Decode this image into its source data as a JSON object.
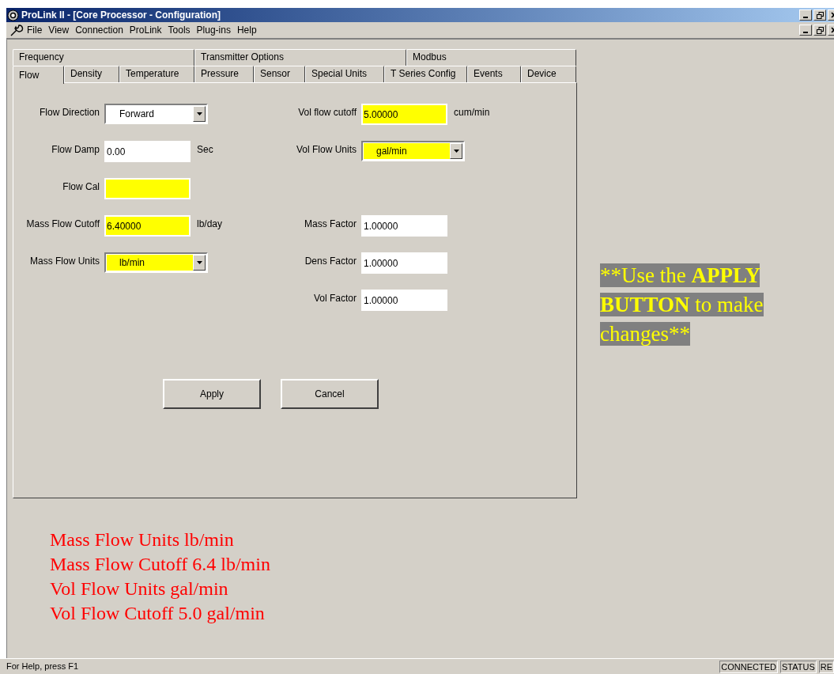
{
  "window": {
    "title": "ProLink II - [Core Processor - Configuration]"
  },
  "menu": [
    "File",
    "View",
    "Connection",
    "ProLink",
    "Tools",
    "Plug-ins",
    "Help"
  ],
  "tab_rows": [
    [
      {
        "label": "Frequency",
        "selected": false
      },
      {
        "label": "Transmitter Options",
        "selected": false
      },
      {
        "label": "Modbus",
        "selected": false
      }
    ],
    [
      {
        "label": "Flow",
        "selected": true
      },
      {
        "label": "Density",
        "selected": false
      },
      {
        "label": "Temperature",
        "selected": false
      },
      {
        "label": "Pressure",
        "selected": false
      },
      {
        "label": "Sensor",
        "selected": false
      },
      {
        "label": "Special Units",
        "selected": false
      },
      {
        "label": "T Series Config",
        "selected": false
      },
      {
        "label": "Events",
        "selected": false
      },
      {
        "label": "Device",
        "selected": false
      }
    ]
  ],
  "form_rows": [
    {
      "left": {
        "label": "Flow Direction",
        "kind": "dropdown",
        "value": "Forward",
        "highlighted": false
      },
      "right": {
        "label": "Vol flow cutoff",
        "kind": "text",
        "value": "5.00000",
        "highlighted": true,
        "unit": "cum/min"
      }
    },
    {
      "left": {
        "label": "Flow Damp",
        "kind": "text",
        "value": "0.00",
        "highlighted": false,
        "unit": "Sec"
      },
      "right": {
        "label": "Vol Flow Units",
        "kind": "dropdown",
        "value": "gal/min",
        "highlighted": true
      }
    },
    {
      "left": {
        "label": "Flow Cal",
        "kind": "text",
        "highlighted": true
      }
    },
    {
      "left": {
        "label": "Mass Flow Cutoff",
        "kind": "text",
        "value": "6.40000",
        "highlighted": true,
        "unit": "lb/day"
      },
      "right": {
        "label": "Mass Factor",
        "kind": "text",
        "value": "1.00000",
        "highlighted": false
      }
    },
    {
      "left": {
        "label": "Mass Flow Units",
        "kind": "dropdown",
        "value": "lb/min",
        "highlighted": true
      },
      "right": {
        "label": "Dens Factor",
        "kind": "text",
        "value": "1.00000",
        "highlighted": false
      }
    },
    {
      "right": {
        "label": "Vol Factor",
        "kind": "text",
        "value": "1.00000",
        "highlighted": false
      }
    }
  ],
  "buttons": [
    "Apply",
    "Cancel"
  ],
  "notes": [
    "Mass Flow Units lb/min",
    "Mass Flow Cutoff 6.4 lb/min",
    "Vol Flow Units gal/min",
    "Vol Flow Cutoff 5.0 gal/min"
  ],
  "callout": [
    {
      "text": "**Use the ",
      "bold": false
    },
    {
      "text": "APPLY BUTTON",
      "bold": true
    },
    {
      "text": " to make changes**",
      "bold": false
    }
  ],
  "status_bar": {
    "help": "For Help, press F1",
    "panes": [
      "CONNECTED",
      "STATUS",
      "RE"
    ]
  }
}
